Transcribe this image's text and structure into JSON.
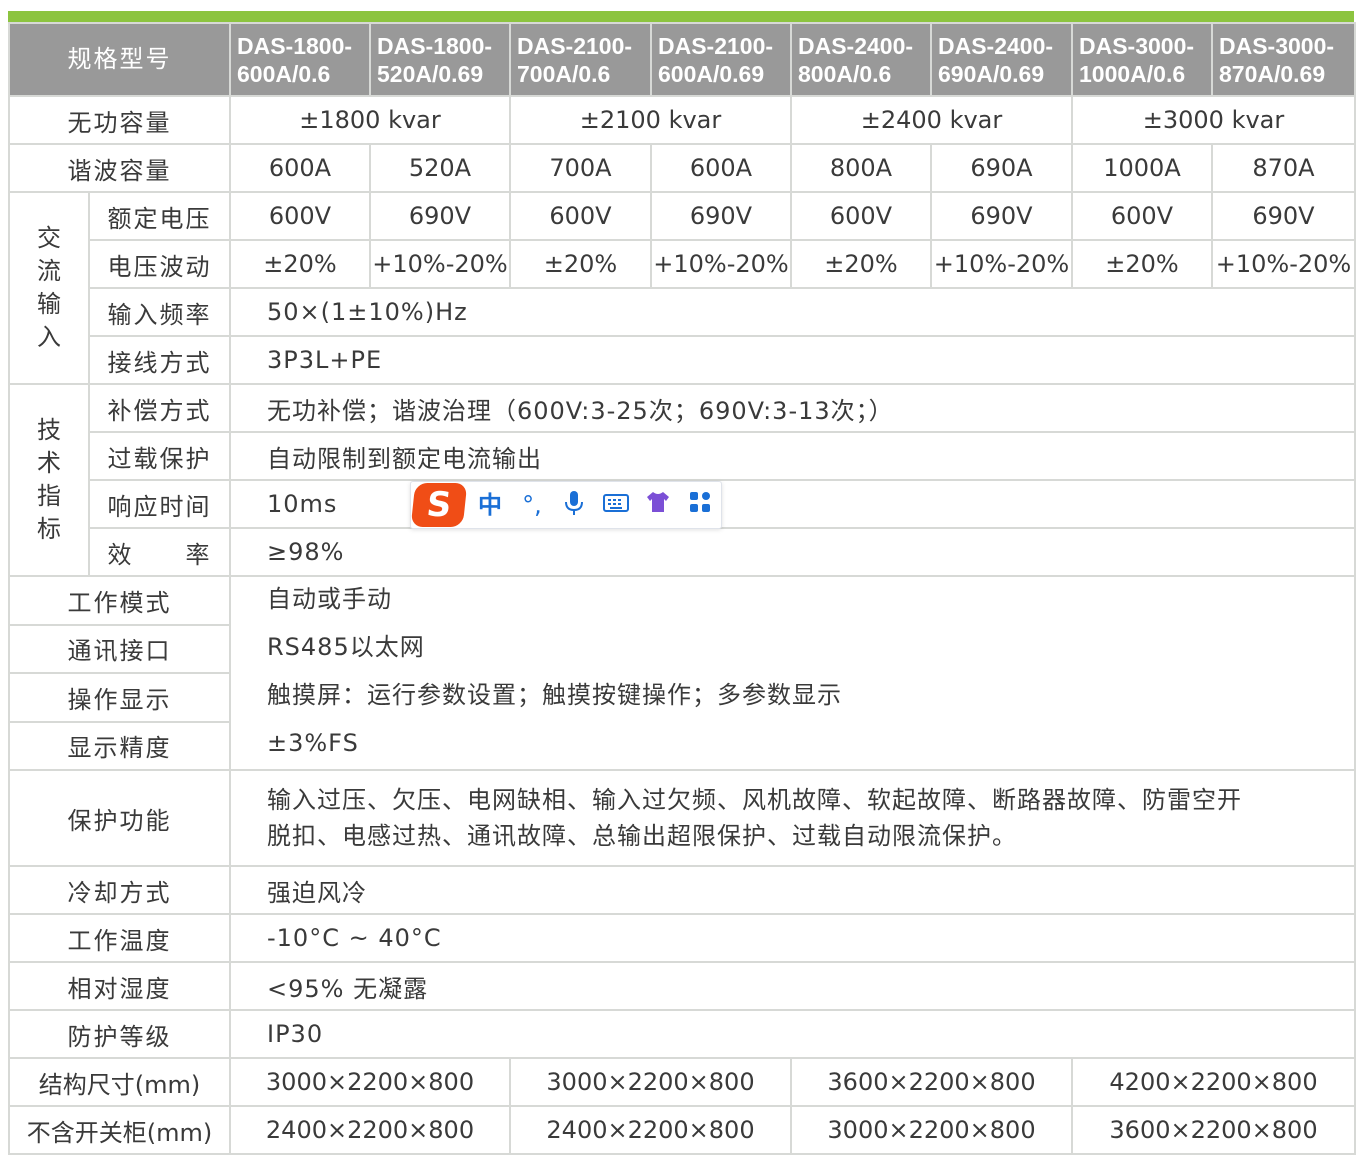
{
  "header": {
    "label": "规格型号",
    "models": [
      "DAS-1800-600A/0.6",
      "DAS-1800-520A/0.69",
      "DAS-2100-700A/0.6",
      "DAS-2100-600A/0.69",
      "DAS-2400-800A/0.6",
      "DAS-2400-690A/0.69",
      "DAS-3000-1000A/0.6",
      "DAS-3000-870A/0.69"
    ],
    "models_line1": [
      "DAS-1800-",
      "DAS-1800-",
      "DAS-2100-",
      "DAS-2100-",
      "DAS-2400-",
      "DAS-2400-",
      "DAS-3000-",
      "DAS-3000-"
    ],
    "models_line2": [
      "600A/0.6",
      "520A/0.69",
      "700A/0.6",
      "600A/0.69",
      "800A/0.6",
      "690A/0.69",
      "1000A/0.6",
      "870A/0.69"
    ]
  },
  "rows": {
    "reactive": {
      "label": "无功容量",
      "values": [
        "±1800 kvar",
        "±2100 kvar",
        "±2400 kvar",
        "±3000 kvar"
      ]
    },
    "harmonic": {
      "label": "谐波容量",
      "values": [
        "600A",
        "520A",
        "700A",
        "600A",
        "800A",
        "690A",
        "1000A",
        "870A"
      ]
    },
    "ac_input": {
      "group": [
        "交",
        "流",
        "输",
        "入"
      ],
      "rated_voltage": {
        "label": "额定电压",
        "values": [
          "600V",
          "690V",
          "600V",
          "690V",
          "600V",
          "690V",
          "600V",
          "690V"
        ]
      },
      "fluctuation": {
        "label": "电压波动",
        "values": [
          "±20%",
          "+10%-20%",
          "±20%",
          "+10%-20%",
          "±20%",
          "+10%-20%",
          "±20%",
          "+10%-20%"
        ]
      },
      "frequency": {
        "label": "输入频率",
        "value": "50×(1±10%)Hz"
      },
      "wiring": {
        "label": "接线方式",
        "value": "3P3L+PE"
      }
    },
    "tech": {
      "group": [
        "技",
        "术",
        "指",
        "标"
      ],
      "compensation": {
        "label": "补偿方式",
        "value": "无功补偿；谐波治理（600V:3-25次；690V:3-13次；）"
      },
      "overload": {
        "label": "过载保护",
        "value": "自动限制到额定电流输出"
      },
      "response": {
        "label": "响应时间",
        "value": "10ms"
      },
      "efficiency": {
        "label": "效　　率",
        "value": "≥98%"
      }
    },
    "work_mode": {
      "label": "工作模式",
      "value": "自动或手动"
    },
    "comm": {
      "label": "通讯接口",
      "value": "RS485以太网"
    },
    "display": {
      "label": "操作显示",
      "value": "触摸屏：运行参数设置；触摸按键操作；多参数显示"
    },
    "accuracy": {
      "label": "显示精度",
      "value": "±3%FS"
    },
    "protection": {
      "label": "保护功能",
      "line1": "输入过压、欠压、电网缺相、输入过欠频、风机故障、软起故障、断路器故障、防雷空开",
      "line2": "脱扣、电感过热、通讯故障、总输出超限保护、过载自动限流保护。"
    },
    "cooling": {
      "label": "冷却方式",
      "value": "强迫风冷"
    },
    "temperature": {
      "label": "工作温度",
      "value": "-10°C ~ 40°C"
    },
    "humidity": {
      "label": "相对湿度",
      "value": "<95% 无凝露"
    },
    "ip": {
      "label": "防护等级",
      "value": "IP30"
    },
    "dimensions": {
      "label": "结构尺寸(mm)",
      "values": [
        "3000×2200×800",
        "3000×2200×800",
        "3600×2200×800",
        "4200×2200×800"
      ]
    },
    "without_switch": {
      "label": "不含开关柜(mm)",
      "values": [
        "2400×2200×800",
        "2400×2200×800",
        "3000×2200×800",
        "3600×2200×800"
      ]
    }
  },
  "ime_toolbar": {
    "logo": "S",
    "mode": "中",
    "punct": "°,",
    "accent": "#f04d16",
    "icons": [
      "sogou-logo-icon",
      "chinese-mode-icon",
      "punctuation-icon",
      "microphone-icon",
      "keyboard-icon",
      "skin-icon",
      "toolbox-icon"
    ]
  },
  "colors": {
    "accent_bar": "#8cc43f",
    "header_bg": "#999999",
    "border": "#d7d9d6"
  }
}
